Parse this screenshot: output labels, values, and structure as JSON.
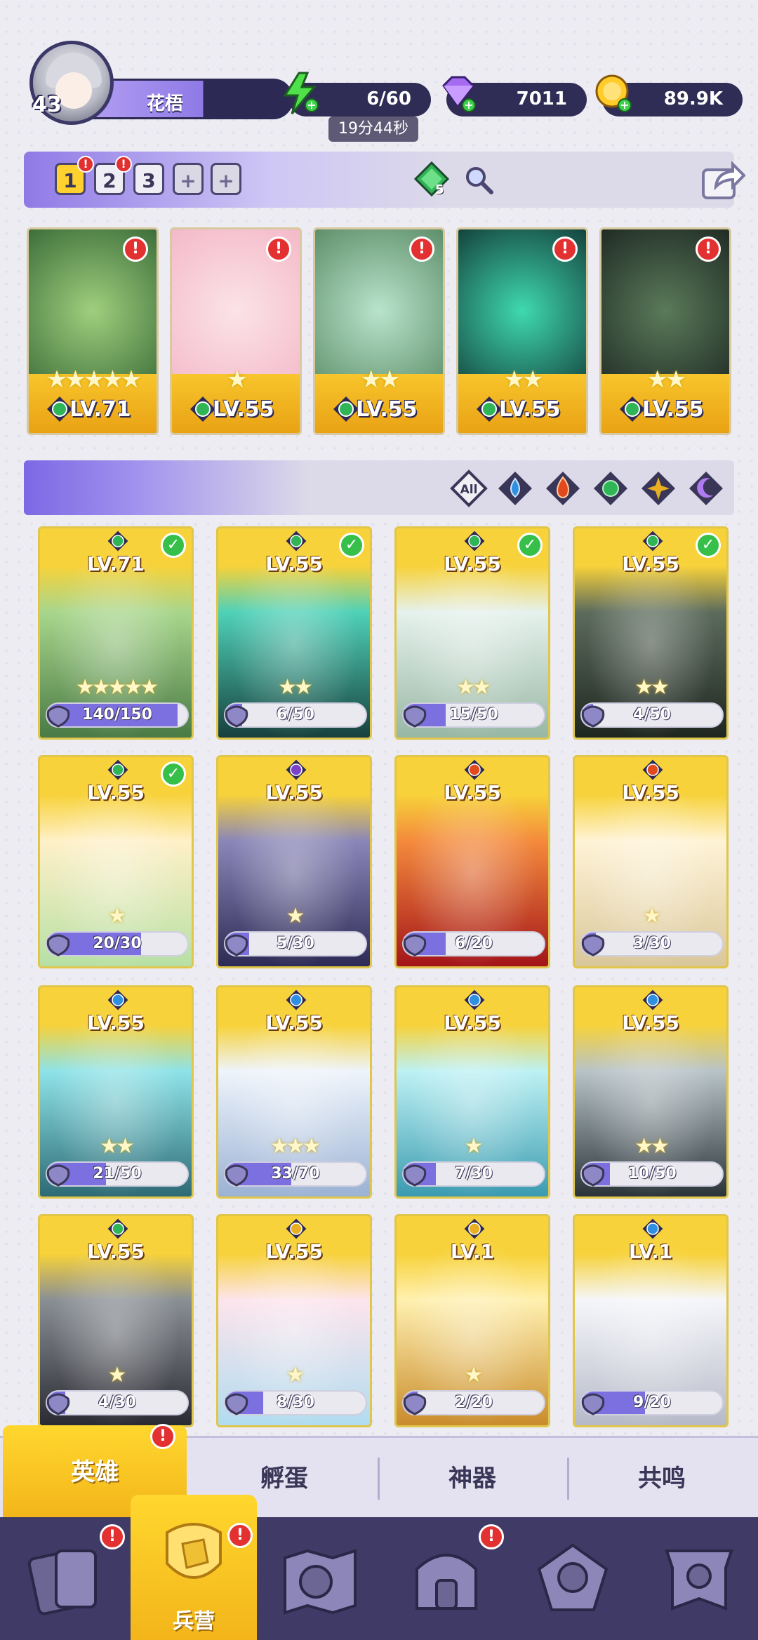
{
  "player": {
    "level": "43",
    "name": "花梧"
  },
  "resources": {
    "energy": "6/60",
    "energy_timer": "19分44秒",
    "gems": "7011",
    "gold": "89.9K"
  },
  "teams": {
    "tabs": [
      "1",
      "2",
      "3",
      "+",
      "+"
    ],
    "active_index": 0,
    "gem_count": "5"
  },
  "team_heroes": [
    {
      "level": "LV.71",
      "stars": "★★★★★",
      "element": "nature",
      "color_a": "#9fcf7d",
      "color_b": "#3d6e3a"
    },
    {
      "level": "LV.55",
      "stars": "★",
      "element": "nature",
      "color_a": "#fbe3e8",
      "color_b": "#f4b9c8"
    },
    {
      "level": "LV.55",
      "stars": "★★",
      "element": "nature",
      "color_a": "#b9e4cc",
      "color_b": "#5e8f6a"
    },
    {
      "level": "LV.55",
      "stars": "★★",
      "element": "nature",
      "color_a": "#3fd9b0",
      "color_b": "#14433e"
    },
    {
      "level": "LV.55",
      "stars": "★★",
      "element": "nature",
      "color_a": "#5a7a5a",
      "color_b": "#202b24"
    }
  ],
  "filters": [
    "All",
    "water",
    "fire",
    "nature",
    "light",
    "dark"
  ],
  "filter_all_label": "All",
  "heroes": [
    {
      "level": "LV.71",
      "stars": "★★★★★",
      "progress": "140/150",
      "ratio": 0.93,
      "element": "nature",
      "checked": true,
      "color_a": "#a8d68c",
      "color_b": "#4a7a45"
    },
    {
      "level": "LV.55",
      "stars": "★★",
      "progress": "6/50",
      "ratio": 0.12,
      "element": "nature",
      "checked": true,
      "color_a": "#4fd1b8",
      "color_b": "#17403d"
    },
    {
      "level": "LV.55",
      "stars": "★★",
      "progress": "15/50",
      "ratio": 0.3,
      "element": "nature",
      "checked": true,
      "color_a": "#e5f1ec",
      "color_b": "#98b7a4"
    },
    {
      "level": "LV.55",
      "stars": "★★",
      "progress": "4/50",
      "ratio": 0.08,
      "element": "nature",
      "checked": true,
      "color_a": "#5c6b5c",
      "color_b": "#1e2620"
    },
    {
      "level": "LV.55",
      "stars": "★",
      "progress": "20/30",
      "ratio": 0.67,
      "element": "nature",
      "checked": true,
      "color_a": "#fff0c8",
      "color_b": "#b7e0a4"
    },
    {
      "level": "LV.55",
      "stars": "★",
      "progress": "5/30",
      "ratio": 0.17,
      "element": "dark",
      "checked": false,
      "color_a": "#8a86b8",
      "color_b": "#2d2a55"
    },
    {
      "level": "LV.55",
      "stars": "",
      "progress": "6/20",
      "ratio": 0.3,
      "element": "fire",
      "checked": false,
      "color_a": "#f48a3c",
      "color_b": "#a3151a"
    },
    {
      "level": "LV.55",
      "stars": "★",
      "progress": "3/30",
      "ratio": 0.1,
      "element": "fire",
      "checked": false,
      "color_a": "#fff3d6",
      "color_b": "#d9c79a"
    },
    {
      "level": "LV.55",
      "stars": "★★",
      "progress": "21/50",
      "ratio": 0.42,
      "element": "water",
      "checked": false,
      "color_a": "#8ee3e8",
      "color_b": "#2d6a74"
    },
    {
      "level": "LV.55",
      "stars": "★★★",
      "progress": "33/70",
      "ratio": 0.47,
      "element": "water",
      "checked": false,
      "color_a": "#eef4fb",
      "color_b": "#9bb2d4"
    },
    {
      "level": "LV.55",
      "stars": "★",
      "progress": "7/30",
      "ratio": 0.23,
      "element": "water",
      "checked": false,
      "color_a": "#bdf1f4",
      "color_b": "#3b9bb0"
    },
    {
      "level": "LV.55",
      "stars": "★★",
      "progress": "10/50",
      "ratio": 0.2,
      "element": "water",
      "checked": false,
      "color_a": "#b8c3c8",
      "color_b": "#2a3438"
    },
    {
      "level": "LV.55",
      "stars": "★",
      "progress": "4/30",
      "ratio": 0.13,
      "element": "nature",
      "checked": false,
      "color_a": "#8a8f94",
      "color_b": "#2a2a32"
    },
    {
      "level": "LV.55",
      "stars": "★",
      "progress": "8/30",
      "ratio": 0.27,
      "element": "light",
      "checked": false,
      "color_a": "#fde4ec",
      "color_b": "#b0dcef"
    },
    {
      "level": "LV.1",
      "stars": "★",
      "progress": "2/20",
      "ratio": 0.1,
      "element": "light",
      "checked": false,
      "color_a": "#fff0b0",
      "color_b": "#c98c2c"
    },
    {
      "level": "LV.1",
      "stars": "",
      "progress": "9/20",
      "ratio": 0.45,
      "element": "water",
      "checked": false,
      "color_a": "#f5f6fa",
      "color_b": "#b6bac8"
    }
  ],
  "subtabs": [
    "英雄",
    "孵蛋",
    "神器",
    "共鸣"
  ],
  "active_subtab": 0,
  "nav": {
    "active_label": "兵营"
  },
  "alert_mark": "!",
  "check_mark": "✓",
  "colors": {
    "accent_yellow": "#ffd12e",
    "accent_purple": "#7d68e4",
    "nav_bg": "#3f3a66",
    "alert_red": "#e33131",
    "nature": "#2fb556",
    "water": "#2f8fe0",
    "fire": "#e24a1e",
    "light": "#e8b020",
    "dark": "#7a42c8"
  }
}
